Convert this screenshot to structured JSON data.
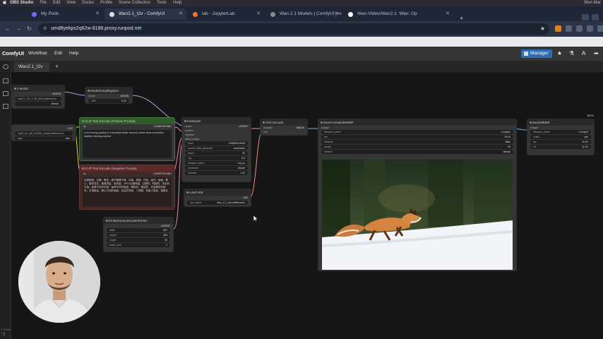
{
  "macos_menubar": {
    "apple": "",
    "items": [
      "OBS Studio",
      "File",
      "Edit",
      "View",
      "Docks",
      "Profile",
      "Scene Collection",
      "Tools",
      "Help"
    ],
    "clock": "Mon Mar"
  },
  "browser": {
    "tabs": [
      {
        "title": "My Pods",
        "active": false
      },
      {
        "title": "Wan2.1_t2v - ComfyUI",
        "active": true
      },
      {
        "title": "lab - JupyterLab",
        "active": false
      },
      {
        "title": "Wan 2.1 Models | ComfyUI_ex",
        "active": false
      },
      {
        "title": "Wan-Video/Wan2.1: Wan: Op",
        "active": false
      }
    ],
    "new_tab": "+",
    "url": "umd8yekps2q62w-8188.proxy.runpod.net",
    "site_icon": "⚙",
    "bookmark_icon": "★",
    "nav": {
      "back": "←",
      "forward": "→",
      "reload": "↻"
    },
    "accent_color": "#2f6db4"
  },
  "comfyui": {
    "logo": "ComfyUI",
    "menu": {
      "workflow": "Workflow",
      "edit": "Edit",
      "help": "Help"
    },
    "manager_label": "Manager",
    "workflow_tab": "Wan2.1_t2v",
    "workflow_plus": "+",
    "hud": {
      "line1": "T: 0.00s",
      "line2": "I: 0"
    }
  },
  "nodes": {
    "load_model": {
      "title": "n Model",
      "output": "MODEL",
      "name_value": "wan2.1_t2v_1.3B_fp16.safetensors",
      "dtype_label": "",
      "dtype_value": "default"
    },
    "model_sampling": {
      "title": "ModelSamplingSD3",
      "input": "model",
      "output": "MODEL",
      "shift_label": "shift",
      "shift_value": "8.00"
    },
    "load_clip": {
      "clip_name": "umt5_xxl_fp8_e4m3fn_scaled.safetensors",
      "type_label": "type",
      "type_value": "wan",
      "output": "CLIP"
    },
    "positive": {
      "title": "CLIP Text Encode (Positive Prompt)",
      "input": "clip",
      "output": "CONDITIONING",
      "text": "a fox moving quickly in a beautiful winter scenery nature trees mountains daytime tracking camera"
    },
    "negative": {
      "title": "CLIP Text Encode (Negative Prompt)",
      "input": "clip",
      "output": "CONDITIONING",
      "text": "色调艳丽，过曝，静态，细节模糊不清，字幕，风格，作品，画作，画面，静止，整体发灰，最差质量，低质量，JPEG压缩残留，丑陋的，残缺的，多余的手指，画得不好的手部，画得不好的脸部，畸形的，毁容的，形态畸形的肢体，手指融合，静止不动的画面，杂乱的背景，三条腿，背景人很多，倒着走"
    },
    "latent": {
      "title": "EmptyHunyuanLatentVideo",
      "output": "LATENT",
      "widgets": [
        {
          "label": "width",
          "value": "832"
        },
        {
          "label": "height",
          "value": "480"
        },
        {
          "label": "length",
          "value": "33"
        },
        {
          "label": "batch_size",
          "value": "1"
        }
      ]
    },
    "ksampler": {
      "title": "KSampler",
      "inputs": [
        "model",
        "positive",
        "negative",
        "latent_image"
      ],
      "output": "LATENT",
      "widgets": [
        {
          "label": "seed",
          "value": "103836144939"
        },
        {
          "label": "control_after_generate",
          "value": "randomize"
        },
        {
          "label": "steps",
          "value": "30"
        },
        {
          "label": "cfg",
          "value": "6.0"
        },
        {
          "label": "sampler_name",
          "value": "uni_pc"
        },
        {
          "label": "scheduler",
          "value": "simple"
        },
        {
          "label": "denoise",
          "value": "1.00"
        }
      ]
    },
    "vae_loader": {
      "title": "Load VAE",
      "output": "VAE",
      "vae_name_label": "vae_name",
      "vae_name_value": "wan_2.1_vae.safetensors"
    },
    "vae_decode": {
      "title": "VAE Decode",
      "inputs": [
        "samples",
        "vae"
      ],
      "output": "IMAGE"
    },
    "save_animated": {
      "title": "SaveAnimatedWEBP",
      "input": "images",
      "widgets": [
        {
          "label": "filename_prefix",
          "value": "ComfyUI"
        },
        {
          "label": "fps",
          "value": "16.00"
        },
        {
          "label": "lossless",
          "value": "false"
        },
        {
          "label": "quality",
          "value": "90"
        },
        {
          "label": "method",
          "value": "default"
        }
      ]
    },
    "save_webm": {
      "title": "SaveWEBM",
      "badge": "BETA",
      "input": "images",
      "widgets": [
        {
          "label": "filename_prefix",
          "value": "ComfyUI"
        },
        {
          "label": "codec",
          "value": "vp9"
        },
        {
          "label": "fps",
          "value": "24.00"
        },
        {
          "label": "crf",
          "value": "32.00"
        }
      ]
    }
  }
}
